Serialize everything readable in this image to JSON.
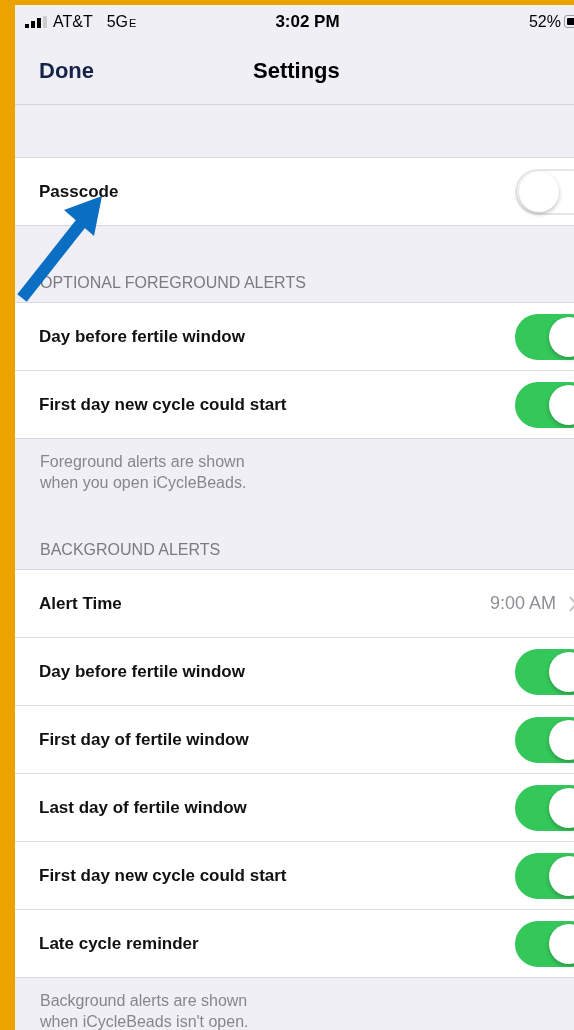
{
  "status_bar": {
    "carrier": "AT&T",
    "network": "5G",
    "network_suffix": "E",
    "time": "3:02 PM",
    "battery": "52%"
  },
  "nav": {
    "back": "Done",
    "title": "Settings"
  },
  "sections": [
    {
      "rows": [
        {
          "kind": "toggle",
          "label": "Passcode",
          "on": false
        }
      ]
    },
    {
      "header": "OPTIONAL FOREGROUND ALERTS",
      "rows": [
        {
          "kind": "toggle",
          "label": "Day before fertile window",
          "on": true
        },
        {
          "kind": "toggle",
          "label": "First day new cycle could start",
          "on": true
        }
      ],
      "footer": "Foreground alerts are shown\nwhen you open iCycleBeads."
    },
    {
      "header": "BACKGROUND ALERTS",
      "rows": [
        {
          "kind": "value",
          "label": "Alert Time",
          "value": "9:00 AM"
        },
        {
          "kind": "toggle",
          "label": "Day before fertile window",
          "on": true
        },
        {
          "kind": "toggle",
          "label": "First day of fertile window",
          "on": true
        },
        {
          "kind": "toggle",
          "label": "Last day of fertile window",
          "on": true
        },
        {
          "kind": "toggle",
          "label": "First day new cycle could start",
          "on": true
        },
        {
          "kind": "toggle",
          "label": "Late cycle reminder",
          "on": true
        }
      ],
      "footer": "Background alerts are shown\nwhen iCycleBeads isn't open."
    }
  ]
}
